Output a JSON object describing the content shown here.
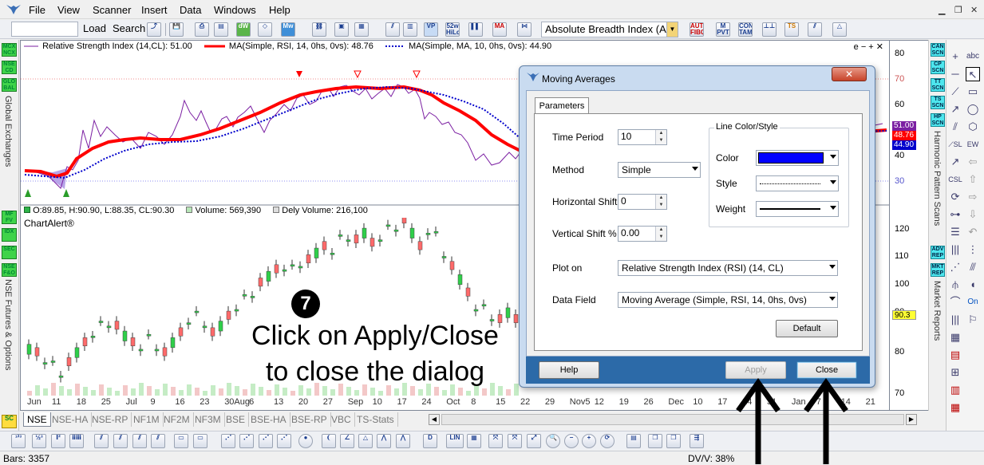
{
  "menu": {
    "items": [
      "File",
      "View",
      "Scanner",
      "Insert",
      "Data",
      "Windows",
      "Help"
    ]
  },
  "toolbar": {
    "load_label": "Load",
    "search_label": "Search",
    "indicator_select": "Absolute Breadth Index (ABI",
    "icons": [
      "52w HiLo",
      "MA",
      "AUTO FIBO",
      "M PVT",
      "CON TAM"
    ]
  },
  "left_strip": {
    "tags_top": [
      "MCX NCX",
      "NSE CD",
      "GLO BAL"
    ],
    "label_top": "Global Exchanges",
    "tags_bottom": [
      "MF FV",
      "IDX",
      "SEC",
      "NSE F&O"
    ],
    "label_bottom": "NSE Futures & Options"
  },
  "rsi_pane": {
    "header_rsi": "Relative Strength Index (14,CL): 51.00",
    "header_ma1": "MA(Simple, RSI, 14, 0hs, 0vs): 48.76",
    "header_ma2": "MA(Simple, MA, 10, 0hs, 0vs): 44.90",
    "header_controls": "e − + ✕",
    "axis": [
      "80",
      "70",
      "60",
      "50",
      "40",
      "30"
    ],
    "values": [
      "51.00",
      "48.76",
      "44.90"
    ],
    "colors": {
      "rsi": "#7b1fa2",
      "ma1": "#ff0000",
      "ma2": "#0000cc"
    }
  },
  "price_pane": {
    "header_ohlc": "O:89.85, H:90.90, L:88.35, CL:90.30",
    "header_volume": "Volume: 569,390",
    "header_dely": "Dely Volume: 216,100",
    "watermark": "ChartAlert®",
    "axis": [
      "120",
      "110",
      "100",
      "90",
      "80",
      "70"
    ],
    "current": "90.3"
  },
  "x_axis": [
    "Jun",
    "11",
    "18",
    "25",
    "Jul",
    "9",
    "16",
    "23",
    "30Aug",
    "6",
    "13",
    "20",
    "27",
    "Sep",
    "10",
    "17",
    "24",
    "Oct",
    "8",
    "15",
    "22",
    "29",
    "Nov5",
    "12",
    "19",
    "26",
    "Dec",
    "10",
    "17",
    "24",
    "31",
    "Jan",
    "7",
    "14",
    "21"
  ],
  "right_strip": {
    "tags_top": [
      "CAN SCN",
      "CP SCN",
      "TT SCN",
      "TS SCN",
      "HP SCN"
    ],
    "label_top": "Harmonic Pattern Scans",
    "tags_bottom": [
      "ADV REP",
      "MKT REP"
    ],
    "label_bottom": "Market Reports"
  },
  "tabs": [
    "NSE",
    "NSE-HA",
    "NSE-RP",
    "NF1M",
    "NF2M",
    "NF3M",
    "BSE",
    "BSE-HA",
    "BSE-RP",
    "VBC",
    "TS-Stats"
  ],
  "status": {
    "bars": "Bars: 3357",
    "dvv": "DV/V: 38%"
  },
  "dialog": {
    "title": "Moving Averages",
    "tab": "Parameters",
    "time_period_label": "Time Period",
    "time_period_value": "10",
    "method_label": "Method",
    "method_value": "Simple",
    "hshift_label": "Horizontal Shift",
    "hshift_value": "0",
    "vshift_label": "Vertical Shift %",
    "vshift_value": "0.00",
    "plot_on_label": "Plot on",
    "plot_on_value": "Relative Strength Index (RSI) (14, CL)",
    "data_field_label": "Data Field",
    "data_field_value": "Moving Average (Simple, RSI, 14, 0hs, 0vs)",
    "line_group": "Line Color/Style",
    "color_label": "Color",
    "color_value": "#0000ff",
    "style_label": "Style",
    "weight_label": "Weight",
    "default_label": "Default",
    "help_label": "Help",
    "apply_label": "Apply",
    "close_label": "Close"
  },
  "annotation": {
    "step": "❼",
    "line1": "Click on Apply/Close",
    "line2": "to close the dialog"
  }
}
